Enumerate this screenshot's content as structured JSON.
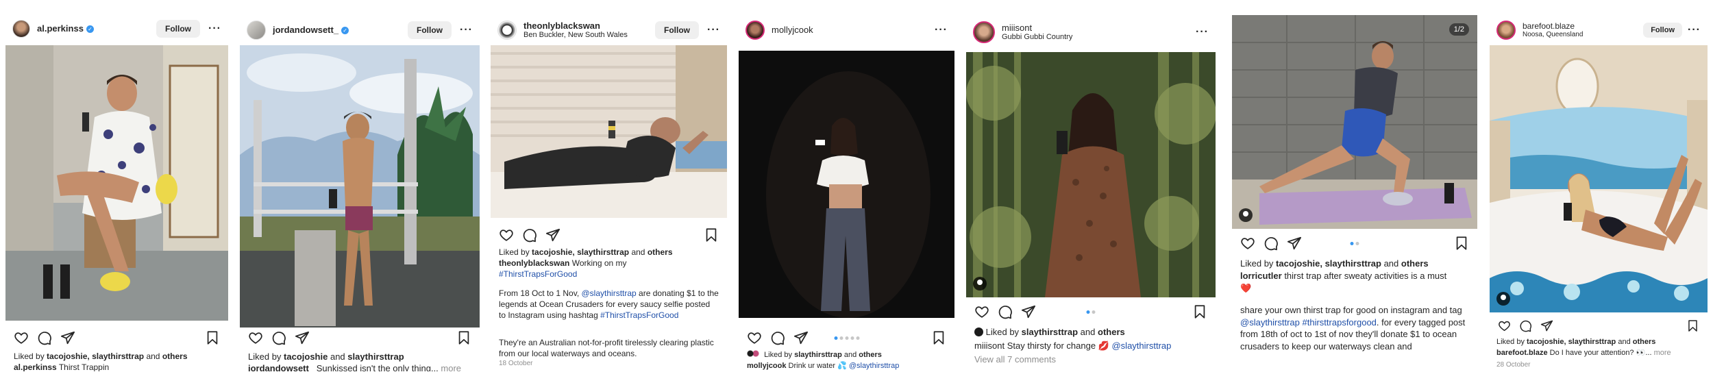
{
  "posts": [
    {
      "username": "al.perkinss",
      "verified": true,
      "follow_label": "Follow",
      "liked_by_prefix": "Liked by",
      "liked_users": "tacojoshie, slaythirsttrap",
      "liked_and": "and",
      "liked_others": "others",
      "caption_user": "al.perkinss",
      "caption_text": "Thirst Trappin"
    },
    {
      "username": "jordandowsett_",
      "verified": true,
      "follow_label": "Follow",
      "liked_by_prefix": "Liked by",
      "liked_users": "tacojoshie",
      "liked_and": "and",
      "liked_others": "slaythirsttrap",
      "caption_user": "jordandowsett_",
      "caption_text": "Sunkissed isn't the only thing...",
      "more_label": "more"
    },
    {
      "username": "theonlyblackswan",
      "location": "Ben Buckler, New South Wales",
      "follow_label": "Follow",
      "liked_by_prefix": "Liked by",
      "liked_users": "tacojoshie, slaythirsttrap",
      "liked_and": "and",
      "liked_others": "others",
      "caption_user": "theonlyblackswan",
      "caption_text": "Working on my",
      "hashtag1": "#ThirstTrapsForGood",
      "para2_a": "From 18 Oct to 1 Nov,",
      "para2_mention": "@slaythirsttrap",
      "para2_b": "are donating $1 to the legends at Ocean Crusaders for every saucy selfie posted to Instagram using hashtag",
      "hashtag2": "#ThirstTrapsForGood",
      "para3": "They're an Australian not-for-profit tirelessly clearing plastic from our local waterways and oceans.",
      "date": "18 October"
    },
    {
      "username": "mollyjcook",
      "liked_by_prefix": "Liked by",
      "liked_users": "slaythirsttrap",
      "liked_and": "and",
      "liked_others": "others",
      "caption_user": "mollyjcook",
      "caption_text": "Drink ur water",
      "caption_emoji": "💦",
      "caption_mention": "@slaythirsttrap"
    },
    {
      "username": "miiisont",
      "location": "Gubbi Gubbi Country",
      "liked_by_prefix": "Liked by",
      "liked_users": "slaythirsttrap",
      "liked_and": "and",
      "liked_others": "others",
      "caption_user": "miiisont",
      "caption_text": "Stay thirsty for change",
      "caption_emoji": "💋",
      "caption_mention": "@slaythirsttrap",
      "view_comments": "View all 7 comments"
    },
    {
      "counter": "1/2",
      "liked_by_prefix": "Liked by",
      "liked_users": "tacojoshie, slaythirsttrap",
      "liked_and": "and",
      "liked_others": "others",
      "caption_user": "lorricutler",
      "caption_text": "thirst trap after sweaty activities is a must",
      "caption_emoji": "❤️",
      "para2_a": "share your own thirst trap for good on instagram and tag",
      "para2_mention": "@slaythirsttrap",
      "hashtag1": "#thirsttrapsforgood",
      "para2_b": ". for every tagged post from 18th of oct to 1st of nov they'll donate $1 to ocean crusaders to keep our waterways clean and"
    },
    {
      "username": "barefoot.blaze",
      "location": "Noosa, Queensland",
      "follow_label": "Follow",
      "liked_by_prefix": "Liked by",
      "liked_users": "tacojoshie, slaythirsttrap",
      "liked_and": "and",
      "liked_others": "others",
      "caption_user": "barefoot.blaze",
      "caption_text": "Do I have your attention?",
      "caption_emoji": "👀",
      "caption_ellipsis": "...",
      "more_label": "more",
      "date": "28 October"
    }
  ],
  "colors": {
    "link": "#1f4fa8",
    "verified": "#3897f0",
    "follow_bg": "#efefef"
  },
  "icons": [
    "heart-icon",
    "comment-icon",
    "share-icon",
    "bookmark-icon",
    "more-icon",
    "verified-icon",
    "user-tag-icon"
  ]
}
